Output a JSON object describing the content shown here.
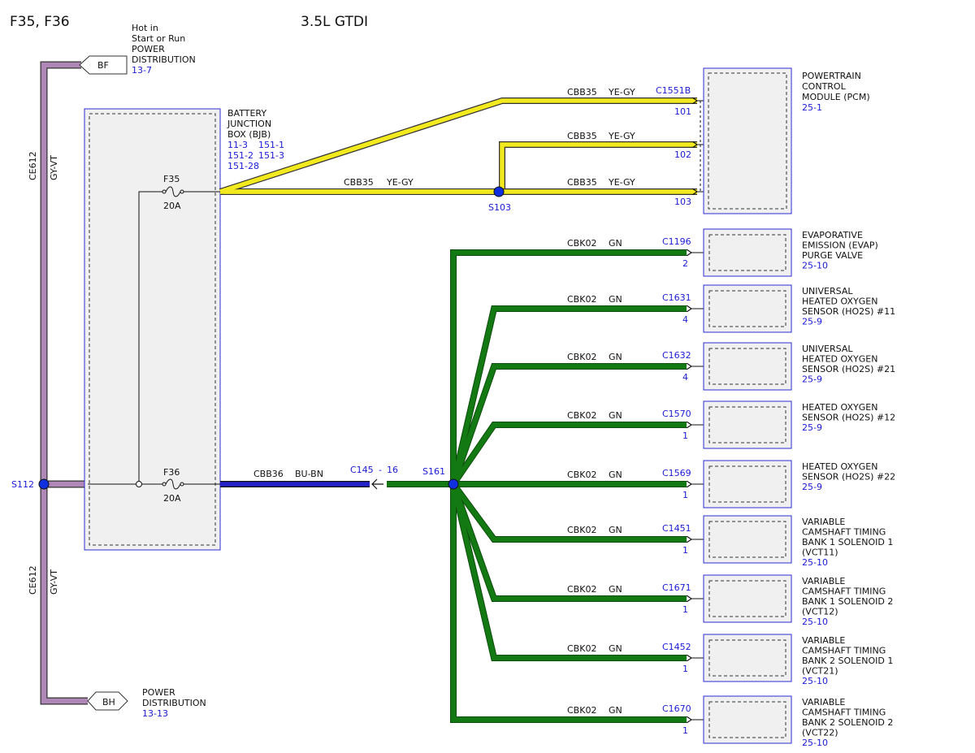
{
  "header": {
    "fuses": "F35, F36",
    "engine": "3.5L GTDI"
  },
  "colors": {
    "wire_gy_vt": "#b088b8",
    "wire_ye_gy": "#f2ea1e",
    "wire_bu_bn": "#2222c8",
    "wire_gn": "#137a13",
    "box_border": "#2b2bd6",
    "box_fill": "#f0f0f0",
    "splice": "#1030e0"
  },
  "connectors": {
    "bf": {
      "tag": "BF",
      "lines": [
        "Hot in",
        "Start or Run",
        "POWER",
        "DISTRIBUTION"
      ],
      "page": "13-7"
    },
    "bh": {
      "tag": "BH",
      "lines": [
        "POWER",
        "DISTRIBUTION"
      ],
      "page": "13-13"
    }
  },
  "ce612_top": {
    "circuit": "CE612",
    "color": "GY-VT"
  },
  "ce612_bottom": {
    "circuit": "CE612",
    "color": "GY-VT"
  },
  "bjb": {
    "lines": [
      "BATTERY",
      "JUNCTION",
      "BOX (BJB)"
    ],
    "refs": [
      "11-3",
      "151-1",
      "151-2",
      "151-3",
      "151-28"
    ],
    "fuse_f35": {
      "name": "F35",
      "rating": "20A"
    },
    "fuse_f36": {
      "name": "F36",
      "rating": "20A"
    }
  },
  "splices": {
    "s112": "S112",
    "s103": "S103",
    "s161": "S161"
  },
  "inline": {
    "connector": "C145",
    "sep": "-",
    "pin": "16"
  },
  "wires": {
    "cbb35_main": {
      "circuit": "CBB35",
      "color": "YE-GY"
    },
    "cbb36": {
      "circuit": "CBB36",
      "color": "BU-BN"
    },
    "pcm_101": {
      "circuit": "CBB35",
      "color": "YE-GY",
      "connector": "C1551B",
      "pin": "101"
    },
    "pcm_102": {
      "circuit": "CBB35",
      "color": "YE-GY",
      "pin": "102"
    },
    "pcm_103": {
      "circuit": "CBB35",
      "color": "YE-GY",
      "pin": "103"
    }
  },
  "pcm": {
    "lines": [
      "POWERTRAIN",
      "CONTROL",
      "MODULE (PCM)"
    ],
    "page": "25-1"
  },
  "loads": [
    {
      "circuit": "CBK02",
      "color": "GN",
      "connector": "C1196",
      "pin": "2",
      "lines": [
        "EVAPORATIVE",
        "EMISSION (EVAP)",
        "PURGE VALVE"
      ],
      "page": "25-10"
    },
    {
      "circuit": "CBK02",
      "color": "GN",
      "connector": "C1631",
      "pin": "4",
      "lines": [
        "UNIVERSAL",
        "HEATED OXYGEN",
        "SENSOR (HO2S) #11"
      ],
      "page": "25-9"
    },
    {
      "circuit": "CBK02",
      "color": "GN",
      "connector": "C1632",
      "pin": "4",
      "lines": [
        "UNIVERSAL",
        "HEATED OXYGEN",
        "SENSOR (HO2S) #21"
      ],
      "page": "25-9"
    },
    {
      "circuit": "CBK02",
      "color": "GN",
      "connector": "C1570",
      "pin": "1",
      "lines": [
        "HEATED OXYGEN",
        "SENSOR (HO2S) #12"
      ],
      "page": "25-9"
    },
    {
      "circuit": "CBK02",
      "color": "GN",
      "connector": "C1569",
      "pin": "1",
      "lines": [
        "HEATED OXYGEN",
        "SENSOR (HO2S) #22"
      ],
      "page": "25-9"
    },
    {
      "circuit": "CBK02",
      "color": "GN",
      "connector": "C1451",
      "pin": "1",
      "lines": [
        "VARIABLE",
        "CAMSHAFT TIMING",
        "BANK 1 SOLENOID 1",
        "(VCT11)"
      ],
      "page": "25-10"
    },
    {
      "circuit": "CBK02",
      "color": "GN",
      "connector": "C1671",
      "pin": "1",
      "lines": [
        "VARIABLE",
        "CAMSHAFT TIMING",
        "BANK 1 SOLENOID 2",
        "(VCT12)"
      ],
      "page": "25-10"
    },
    {
      "circuit": "CBK02",
      "color": "GN",
      "connector": "C1452",
      "pin": "1",
      "lines": [
        "VARIABLE",
        "CAMSHAFT TIMING",
        "BANK 2 SOLENOID 1",
        "(VCT21)"
      ],
      "page": "25-10"
    },
    {
      "circuit": "CBK02",
      "color": "GN",
      "connector": "C1670",
      "pin": "1",
      "lines": [
        "VARIABLE",
        "CAMSHAFT TIMING",
        "BANK 2 SOLENOID 2",
        "(VCT22)"
      ],
      "page": "25-10"
    }
  ]
}
